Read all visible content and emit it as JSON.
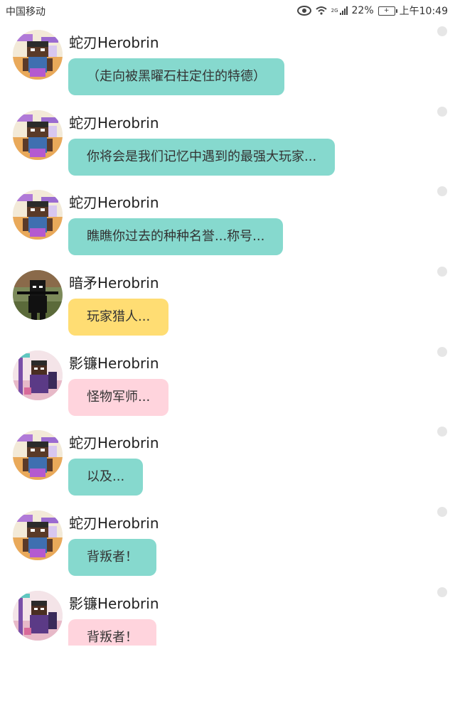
{
  "status_bar": {
    "carrier": "中国移动",
    "network_sup": "2G",
    "battery": "22%",
    "time": "上午10:49"
  },
  "colors": {
    "teal_bubble": "#86D9CE",
    "yellow_bubble": "#FFDD73",
    "pink_bubble": "#FFD4DD"
  },
  "messages": [
    {
      "name": "蛇刃Herobrin",
      "text": "（走向被黑曜石柱定住的特德）",
      "bubble_color": "#86D9CE",
      "avatar": "avatar-snake"
    },
    {
      "name": "蛇刃Herobrin",
      "text": "你将会是我们记忆中遇到的最强大玩家...",
      "bubble_color": "#86D9CE",
      "avatar": "avatar-snake"
    },
    {
      "name": "蛇刃Herobrin",
      "text": "瞧瞧你过去的种种名誉...称号...",
      "bubble_color": "#86D9CE",
      "avatar": "avatar-snake"
    },
    {
      "name": "暗矛Herobrin",
      "text": "玩家猎人...",
      "bubble_color": "#FFDD73",
      "avatar": "avatar-spear"
    },
    {
      "name": "影镰Herobrin",
      "text": "怪物军师...",
      "bubble_color": "#FFD4DD",
      "avatar": "avatar-scythe"
    },
    {
      "name": "蛇刃Herobrin",
      "text": "以及...",
      "bubble_color": "#86D9CE",
      "avatar": "avatar-snake"
    },
    {
      "name": "蛇刃Herobrin",
      "text": "背叛者！",
      "bubble_color": "#86D9CE",
      "avatar": "avatar-snake"
    },
    {
      "name": "影镰Herobrin",
      "text": "背叛者！",
      "bubble_color": "#FFD4DD",
      "avatar": "avatar-scythe"
    }
  ]
}
